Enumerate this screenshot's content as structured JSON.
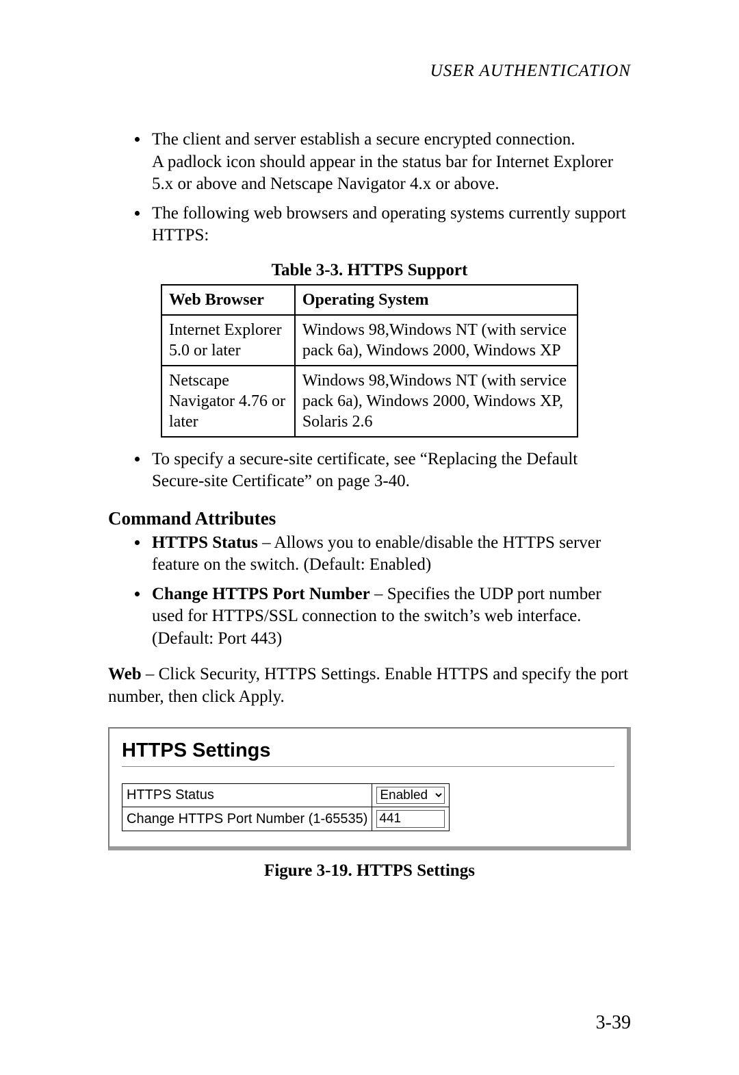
{
  "running_head": "USER AUTHENTICATION",
  "bullets_a": {
    "b1_l1": "The client and server establish a secure encrypted connection.",
    "b1_l2": "A padlock icon should appear in the status bar for Internet Explorer 5.x or above and Netscape Navigator 4.x or above.",
    "b2": "The following web browsers and operating systems currently support HTTPS:"
  },
  "table": {
    "caption": "Table 3-3.  HTTPS Support",
    "headers": {
      "c1": "Web Browser",
      "c2": "Operating System"
    },
    "rows": [
      {
        "c1": "Internet Explorer 5.0 or later",
        "c2": "Windows 98,Windows NT (with service pack 6a), Windows 2000, Windows XP"
      },
      {
        "c1": "Netscape Navigator 4.76 or later",
        "c2": "Windows 98,Windows NT (with service pack 6a), Windows 2000, Windows XP, Solaris 2.6"
      }
    ]
  },
  "bullets_b": {
    "cert": "To specify a secure-site certificate, see “Replacing the Default Secure-site Certificate” on page 3-40."
  },
  "cmd_attr": {
    "heading": "Command Attributes",
    "items": [
      {
        "run_in": "HTTPS Status",
        "rest": " – Allows you to enable/disable the HTTPS server feature on the switch. (Default: Enabled)"
      },
      {
        "run_in": "Change HTTPS Port Number",
        "rest": " – Specifies the UDP port number used for HTTPS/SSL connection to the switch’s web interface. (Default: Port 443)"
      }
    ]
  },
  "web_para": {
    "run_in": "Web",
    "rest": " – Click Security, HTTPS Settings. Enable HTTPS and specify the port number, then click Apply."
  },
  "panel": {
    "title": "HTTPS Settings",
    "rows": {
      "r1_label": "HTTPS Status",
      "r1_value": "Enabled",
      "r2_label": "Change HTTPS Port Number (1-65535)",
      "r2_value": "441"
    }
  },
  "figure_caption": "Figure 3-19.  HTTPS Settings",
  "page_number": "3-39"
}
